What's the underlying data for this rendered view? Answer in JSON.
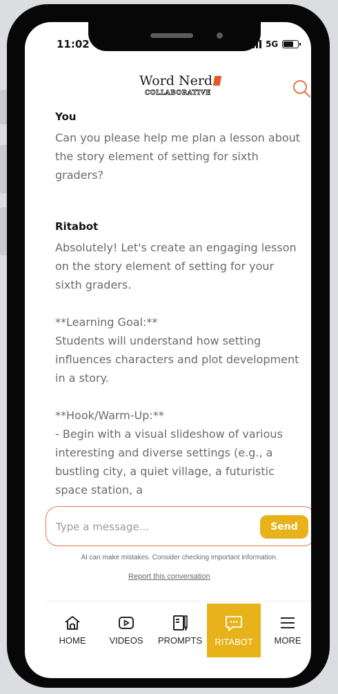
{
  "status_bar": {
    "time": "11:02",
    "network": "5G"
  },
  "header": {
    "logo_main": "Word Nerd",
    "logo_sub": "COLLABORATIVE",
    "search_icon": "search-icon"
  },
  "chat": {
    "messages": [
      {
        "author": "You",
        "paragraphs": [
          "Can you please help me plan a lesson about the story element of setting for sixth graders?"
        ]
      },
      {
        "author": "Ritabot",
        "paragraphs": [
          "Absolutely! Let's create an engaging lesson on the story element of setting for your sixth graders.",
          "**Learning Goal:**\nStudents will understand how setting influences characters and plot development in a story.",
          "**Hook/Warm-Up:**\n- Begin with a visual slideshow of various interesting and diverse settings (e.g., a bustling city, a quiet village, a futuristic space station, a"
        ]
      }
    ]
  },
  "composer": {
    "placeholder": "Type a message...",
    "send_label": "Send",
    "accent_color": "#e9744a",
    "send_color": "#e8b21a"
  },
  "disclaimer": "AI can make mistakes. Consider checking important information.",
  "report_link": "Report this conversation",
  "tabs": [
    {
      "label": "HOME",
      "icon": "home-icon",
      "active": false
    },
    {
      "label": "VIDEOS",
      "icon": "video-play-icon",
      "active": false
    },
    {
      "label": "PROMPTS",
      "icon": "prompts-icon",
      "active": false
    },
    {
      "label": "RITABOT",
      "icon": "chat-bubble-icon",
      "active": true
    },
    {
      "label": "MORE",
      "icon": "menu-icon",
      "active": false
    }
  ]
}
